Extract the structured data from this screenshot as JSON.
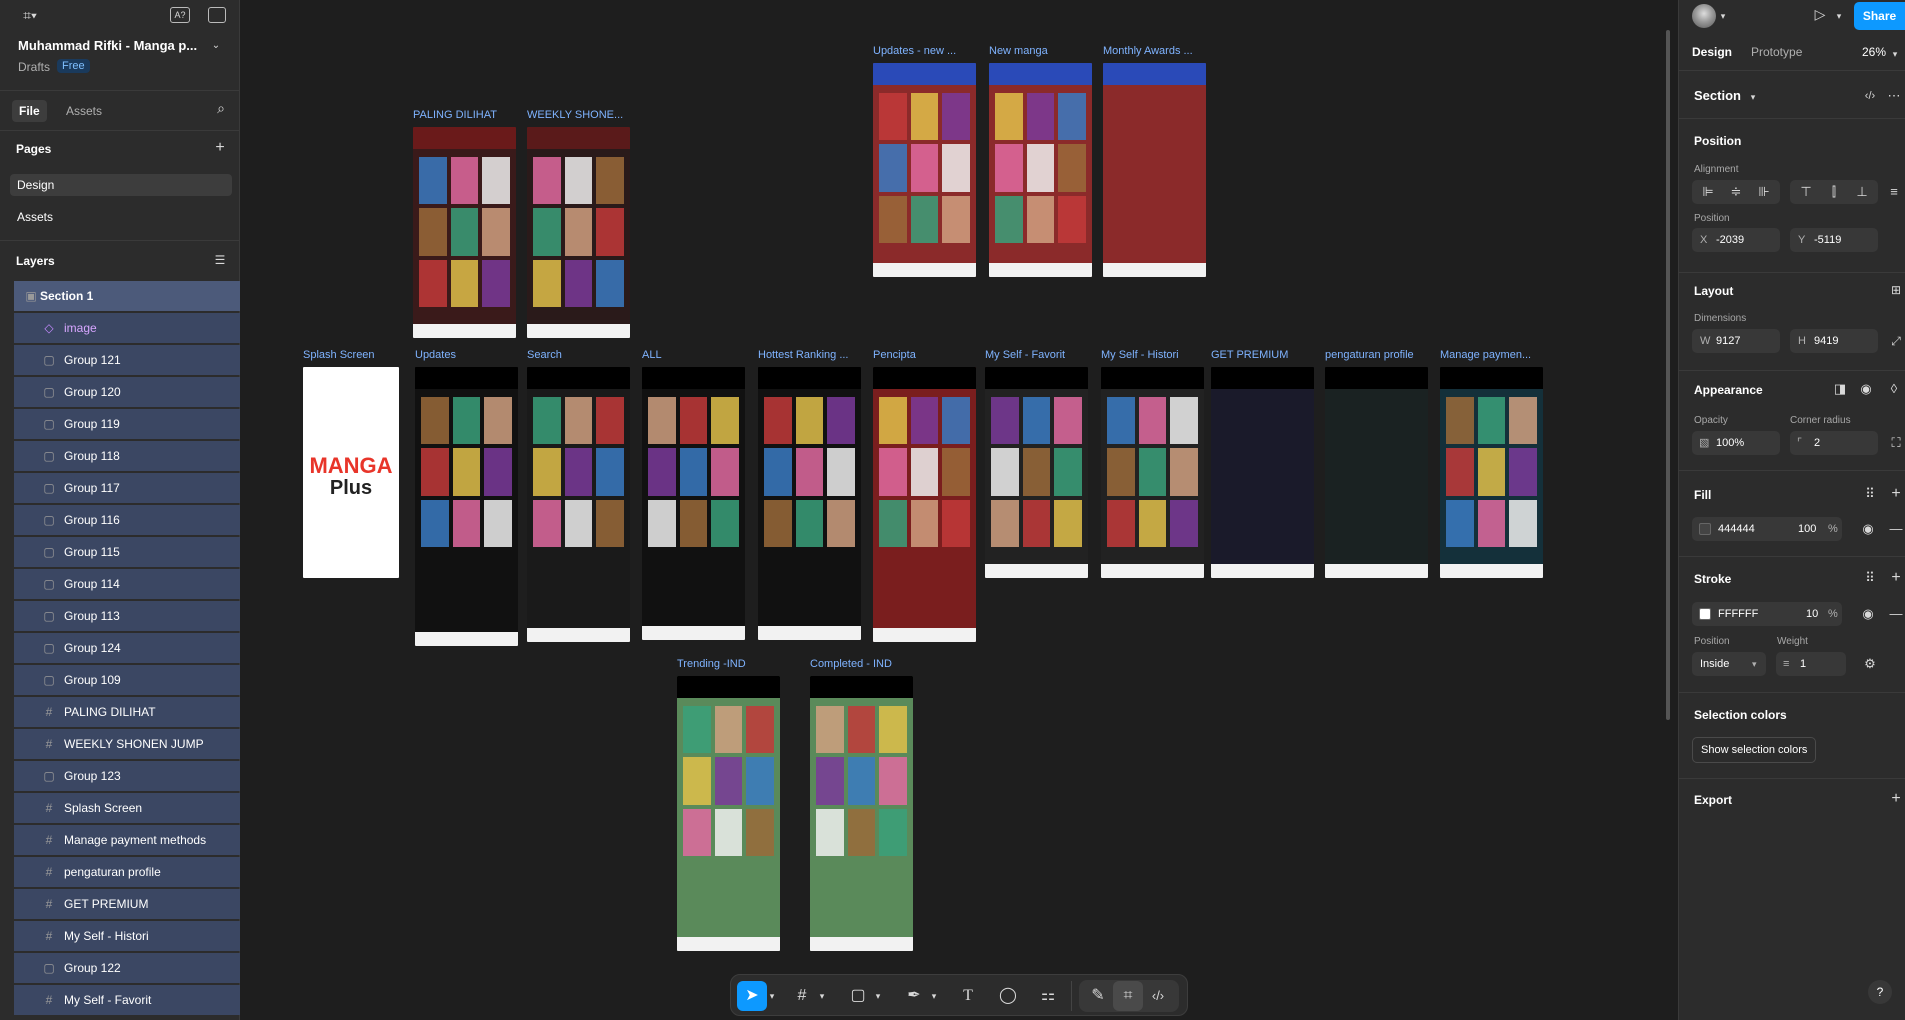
{
  "file": {
    "title": "Muhammad Rifki - Manga p...",
    "location": "Drafts",
    "plan": "Free"
  },
  "left_tabs": {
    "file": "File",
    "assets": "Assets"
  },
  "pages": {
    "header": "Pages",
    "items": [
      "Design",
      "Assets"
    ]
  },
  "layers": {
    "header": "Layers",
    "items": [
      {
        "name": "Section 1",
        "icon": "section-icon"
      },
      {
        "name": "image",
        "icon": "component-icon"
      },
      {
        "name": "Group 121",
        "icon": "group-icon"
      },
      {
        "name": "Group 120",
        "icon": "group-icon"
      },
      {
        "name": "Group 119",
        "icon": "group-icon"
      },
      {
        "name": "Group 118",
        "icon": "group-icon"
      },
      {
        "name": "Group 117",
        "icon": "group-icon"
      },
      {
        "name": "Group 116",
        "icon": "group-icon"
      },
      {
        "name": "Group 115",
        "icon": "group-icon"
      },
      {
        "name": "Group 114",
        "icon": "group-icon"
      },
      {
        "name": "Group 113",
        "icon": "group-icon"
      },
      {
        "name": "Group 124",
        "icon": "group-icon"
      },
      {
        "name": "Group 109",
        "icon": "group-icon"
      },
      {
        "name": "PALING DILIHAT",
        "icon": "frame-icon"
      },
      {
        "name": "WEEKLY SHONEN JUMP",
        "icon": "frame-icon"
      },
      {
        "name": "Group 123",
        "icon": "group-icon"
      },
      {
        "name": "Splash Screen",
        "icon": "frame-icon"
      },
      {
        "name": "Manage payment methods",
        "icon": "frame-icon"
      },
      {
        "name": "pengaturan profile",
        "icon": "frame-icon"
      },
      {
        "name": "GET PREMIUM",
        "icon": "frame-icon"
      },
      {
        "name": "My Self - Histori",
        "icon": "frame-icon"
      },
      {
        "name": "Group 122",
        "icon": "group-icon"
      },
      {
        "name": "My Self - Favorit",
        "icon": "frame-icon"
      }
    ]
  },
  "frames": [
    {
      "label": "Updates - new ...",
      "theme": "#8b2a2a"
    },
    {
      "label": "New manga",
      "theme": "#8b2a2a"
    },
    {
      "label": "Monthly Awards ...",
      "theme": "#8b2a2a"
    },
    {
      "label": "PALING DILIHAT",
      "theme": "#3a1a1a"
    },
    {
      "label": "WEEKLY SHONE...",
      "theme": "#2a1a1a"
    },
    {
      "label": "Splash Screen",
      "theme": "#ffffff"
    },
    {
      "label": "Updates",
      "theme": "#111111"
    },
    {
      "label": "Search",
      "theme": "#1a1a1a"
    },
    {
      "label": "ALL",
      "theme": "#111111"
    },
    {
      "label": "Hottest Ranking ...",
      "theme": "#111111"
    },
    {
      "label": "Pencipta",
      "theme": "#7a1e1e"
    },
    {
      "label": "My Self - Favorit",
      "theme": "#222222"
    },
    {
      "label": "My Self - Histori",
      "theme": "#222222"
    },
    {
      "label": "GET PREMIUM",
      "theme": "#1a1a2a"
    },
    {
      "label": "pengaturan profile",
      "theme": "#1a2222"
    },
    {
      "label": "Manage paymen...",
      "theme": "#14303a"
    },
    {
      "label": "Trending -IND",
      "theme": "#5a8a5a"
    },
    {
      "label": "Completed - IND",
      "theme": "#5a8a5a"
    }
  ],
  "splash": {
    "line1": "MANGA",
    "line2": "Plus"
  },
  "right": {
    "share": "Share",
    "tabs": {
      "design": "Design",
      "prototype": "Prototype"
    },
    "zoom": "26%",
    "selection_type": "Section",
    "position": {
      "header": "Position",
      "alignment": "Alignment",
      "position_label": "Position",
      "x_label": "X",
      "x": "-2039",
      "y_label": "Y",
      "y": "-5119"
    },
    "layout": {
      "header": "Layout",
      "dimensions": "Dimensions",
      "w_label": "W",
      "w": "9127",
      "h_label": "H",
      "h": "9419"
    },
    "appearance": {
      "header": "Appearance",
      "opacity_label": "Opacity",
      "opacity": "100%",
      "radius_label": "Corner radius",
      "radius": "2"
    },
    "fill": {
      "header": "Fill",
      "hex": "444444",
      "opacity": "100",
      "unit": "%"
    },
    "stroke": {
      "header": "Stroke",
      "hex": "FFFFFF",
      "opacity": "10",
      "unit": "%",
      "position_label": "Position",
      "weight_label": "Weight",
      "position": "Inside",
      "weight": "1"
    },
    "selection_colors": {
      "header": "Selection colors",
      "button": "Show selection colors"
    },
    "export": {
      "header": "Export"
    },
    "help": "?"
  },
  "colors": {
    "accent": "#0d99ff",
    "selection": "#4c5a7a",
    "section_label": "#7fb3ff"
  }
}
